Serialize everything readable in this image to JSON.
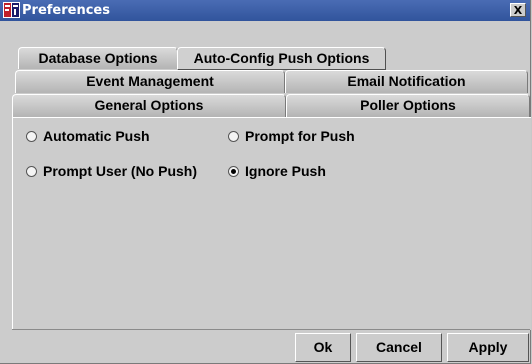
{
  "window": {
    "title": "Preferences",
    "close_label": "X"
  },
  "tabs": {
    "database_options": "Database Options",
    "auto_config_push_options": "Auto-Config Push Options",
    "event_management": "Event Management",
    "email_notification": "Email Notification",
    "general_options": "General Options",
    "poller_options": "Poller Options",
    "selected": "Auto-Config Push Options"
  },
  "push_options": {
    "automatic_push": "Automatic Push",
    "prompt_for_push": "Prompt for Push",
    "prompt_user_no_push": "Prompt User (No Push)",
    "ignore_push": "Ignore Push",
    "selected": "Ignore Push"
  },
  "buttons": {
    "ok": "Ok",
    "cancel": "Cancel",
    "apply": "Apply"
  },
  "colors": {
    "titlebar": "#3c5fa8",
    "background": "#cccccc"
  },
  "icons": {
    "app": "app-logo-icon",
    "close": "close-icon"
  }
}
